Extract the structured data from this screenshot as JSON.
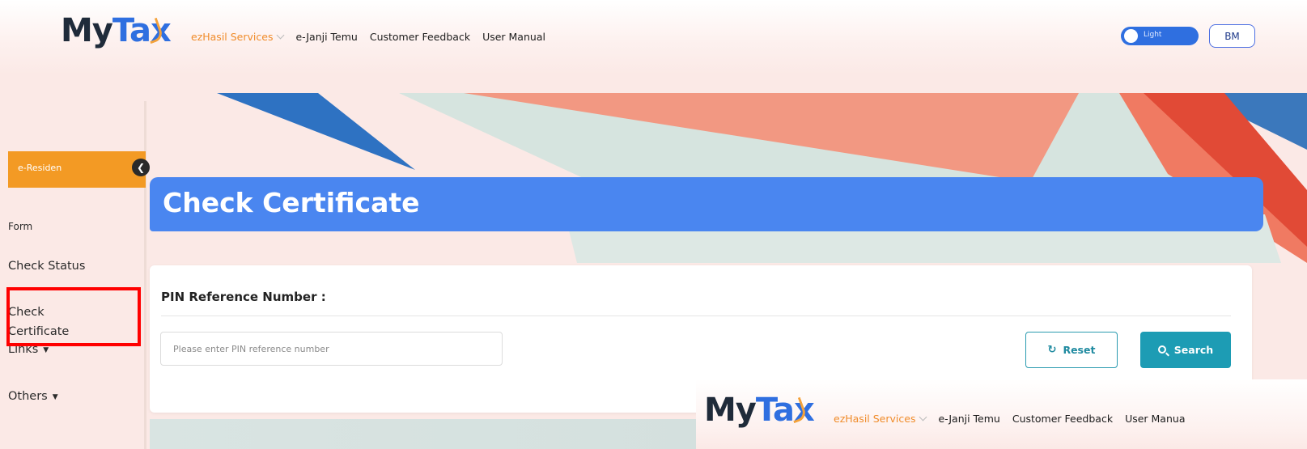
{
  "header": {
    "logo": {
      "my": "My",
      "tax": "Tax"
    },
    "nav": [
      {
        "label": "ezHasil Services",
        "has_dropdown": true
      },
      {
        "label": "e-Janji Temu"
      },
      {
        "label": "Customer Feedback"
      },
      {
        "label": "User Manual"
      }
    ],
    "theme_toggle": {
      "label": "Light"
    },
    "language_button": "BM"
  },
  "sidebar": {
    "active": "e-Residen",
    "collapse_icon": "chevron-left-icon",
    "items": [
      {
        "label": "Form"
      },
      {
        "label": "Check Status"
      },
      {
        "label": "Check Certificate"
      },
      {
        "label": "Links",
        "has_dropdown": true
      },
      {
        "label": "Others",
        "has_dropdown": true
      }
    ]
  },
  "page": {
    "title": "Check Certificate"
  },
  "form": {
    "label": "PIN Reference Number :",
    "input_placeholder": "Please enter PIN reference number",
    "input_value": "",
    "reset_label": "Reset",
    "search_label": "Search"
  },
  "overlay": {
    "logo": {
      "my": "My",
      "tax": "Tax"
    },
    "nav": [
      {
        "label": "ezHasil Services"
      },
      {
        "label": "e-Janji Temu"
      },
      {
        "label": "Customer Feedback"
      },
      {
        "label": "User Manua"
      }
    ]
  },
  "colors": {
    "brand_blue": "#2f6fe0",
    "title_bar": "#4a86f0",
    "accent_orange": "#f39a24",
    "action_teal": "#1d9cb4",
    "highlight_red": "#ff0000",
    "page_bg": "#fbe9e6"
  }
}
